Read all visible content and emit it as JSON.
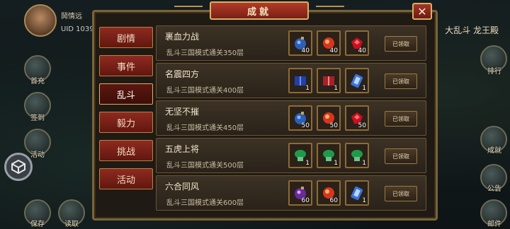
{
  "player": {
    "name": "鬨情远",
    "uid": "UID 1039"
  },
  "top_right_text": "大乱斗 龙王殿",
  "left_buttons": [
    {
      "label": "首充"
    },
    {
      "label": "签到"
    },
    {
      "label": "活动"
    },
    {
      "label": "保存"
    },
    {
      "label": "读取"
    }
  ],
  "right_buttons": [
    {
      "label": "排行"
    },
    {
      "label": "成就"
    },
    {
      "label": "公告"
    },
    {
      "label": "邮件"
    }
  ],
  "panel": {
    "title": "成就",
    "close_symbol": "✕"
  },
  "tabs": [
    {
      "label": "剧情",
      "active": false
    },
    {
      "label": "事件",
      "active": false
    },
    {
      "label": "乱斗",
      "active": true
    },
    {
      "label": "毅力",
      "active": false
    },
    {
      "label": "挑战",
      "active": false
    },
    {
      "label": "活动",
      "active": false
    }
  ],
  "achievements": [
    {
      "name": "裹血力战",
      "desc": "乱斗三国模式通关350层",
      "button": "已领取",
      "rewards": [
        {
          "icon": "blue-bomb-icon",
          "count": "40"
        },
        {
          "icon": "red-orb-icon",
          "count": "40"
        },
        {
          "icon": "red-gem-icon",
          "count": "40"
        }
      ]
    },
    {
      "name": "名震四方",
      "desc": "乱斗三国模式通关400层",
      "button": "已领取",
      "rewards": [
        {
          "icon": "blue-book-icon",
          "count": "1"
        },
        {
          "icon": "red-book-icon",
          "count": "1"
        },
        {
          "icon": "blue-scroll-icon",
          "count": "1"
        }
      ]
    },
    {
      "name": "无坚不摧",
      "desc": "乱斗三国模式通关450层",
      "button": "已领取",
      "rewards": [
        {
          "icon": "blue-bomb-icon",
          "count": "50"
        },
        {
          "icon": "red-orb-icon",
          "count": "50"
        },
        {
          "icon": "red-gem-icon",
          "count": "50"
        }
      ]
    },
    {
      "name": "五虎上将",
      "desc": "乱斗三国模式通关500层",
      "button": "已领取",
      "rewards": [
        {
          "icon": "green-jade-icon",
          "count": "1"
        },
        {
          "icon": "green-jade-icon",
          "count": "1"
        },
        {
          "icon": "green-jade-icon",
          "count": "1"
        }
      ]
    },
    {
      "name": "六合同风",
      "desc": "乱斗三国模式通关600层",
      "button": "已领取",
      "rewards": [
        {
          "icon": "purple-bomb-icon",
          "count": "60"
        },
        {
          "icon": "red-orb-icon",
          "count": "60"
        },
        {
          "icon": "blue-scroll-icon",
          "count": "1"
        }
      ]
    }
  ]
}
